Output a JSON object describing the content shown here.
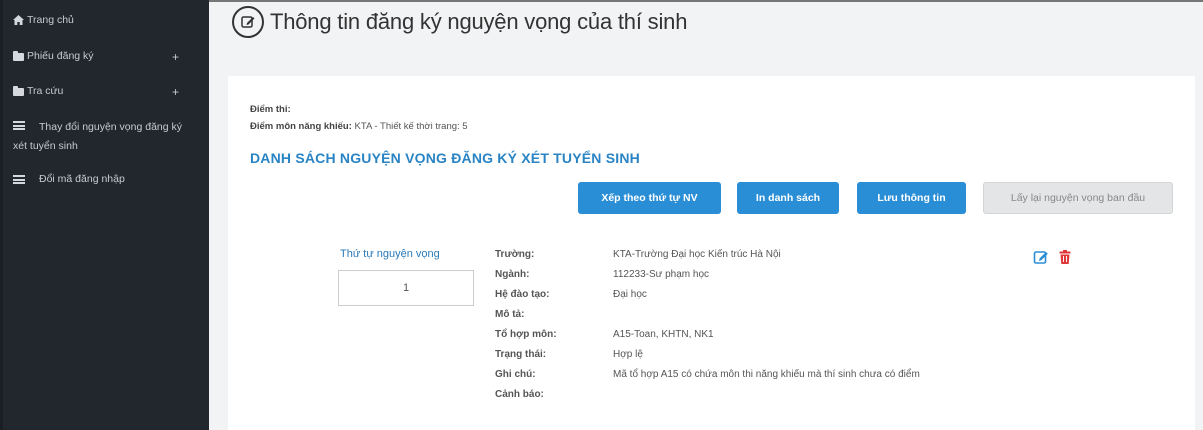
{
  "sidebar": {
    "items": [
      {
        "label": "Trang chủ"
      },
      {
        "label": "Phiếu đăng ký",
        "suffix": "+"
      },
      {
        "label": "Tra cứu",
        "suffix": "+"
      },
      {
        "label": "Thay đổi nguyện vọng đăng ký xét tuyển sinh"
      },
      {
        "label": "Đổi mã đăng nhập"
      }
    ]
  },
  "page": {
    "title": "Thông tin đăng ký nguyện vọng của thí sinh"
  },
  "info": {
    "diem_thi_label": "Điểm thi:",
    "nang_khieu_label": "Điểm môn năng khiếu:",
    "nang_khieu_value": "KTA - Thiết kế thời trang: 5"
  },
  "section": {
    "title": "DANH SÁCH NGUYỆN VỌNG ĐĂNG KÝ XÉT TUYỂN SINH"
  },
  "buttons": {
    "sort": "Xếp theo thứ tự NV",
    "print": "In danh sách",
    "save": "Lưu thông tin",
    "restore": "Lấy lại nguyện vọng ban đầu"
  },
  "wish": {
    "order_label": "Thứ tự nguyện vọng",
    "order_value": "1",
    "labels": {
      "truong": "Trường:",
      "nganh": "Ngành:",
      "he": "Hệ đào tạo:",
      "mota": "Mô tả:",
      "tohop": "Tổ hợp môn:",
      "trangthai": "Trạng thái:",
      "ghichu": "Ghi chú:",
      "canhbao": "Cảnh báo:"
    },
    "values": {
      "truong": "KTA-Trường Đại học Kiến trúc Hà Nội",
      "nganh": "112233-Sư phạm học",
      "he": "Đại học",
      "mota": "",
      "tohop": "A15-Toan, KHTN, NK1",
      "trangthai": "Hợp lệ",
      "ghichu": "Mã tổ hợp A15 có chứa môn thi năng khiếu mà thí sinh chưa có điểm",
      "canhbao": ""
    }
  },
  "colors": {
    "sidebar_bg": "#22272e",
    "accent": "#2a8ed6",
    "title_blue": "#2a84c4",
    "status_green": "#3a9a3a",
    "delete_red": "#e0383a"
  },
  "icons": [
    "home-icon",
    "folder-icon",
    "list-icon",
    "edit-icon",
    "trash-icon"
  ]
}
